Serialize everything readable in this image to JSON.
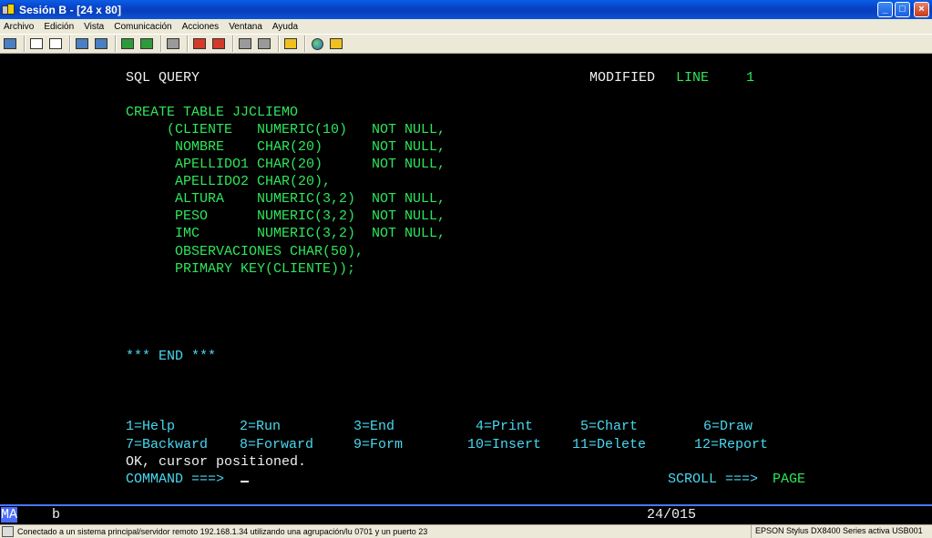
{
  "window": {
    "title": "Sesión B - [24 x 80]",
    "min_glyph": "_",
    "max_glyph": "□",
    "close_glyph": "×"
  },
  "menu": [
    "Archivo",
    "Edición",
    "Vista",
    "Comunicación",
    "Acciones",
    "Ventana",
    "Ayuda"
  ],
  "toolbar": {
    "icons": [
      "print-screen-icon",
      "copy-icon",
      "paste-icon",
      "send-icon",
      "receive-icon",
      "display-icon",
      "session-icon",
      "chart-icon",
      "record-macro-icon",
      "stop-macro-icon",
      "play-macro-icon",
      "macro-icon",
      "clipboard-icon",
      "globe-icon",
      "settings-icon"
    ]
  },
  "terminal": {
    "header_left": "SQL QUERY",
    "header_modified": "MODIFIED",
    "header_line_label": "LINE",
    "header_line_num": "1",
    "sql_lines": [
      "CREATE TABLE JJCLIEMO",
      "     (CLIENTE   NUMERIC(10)   NOT NULL,",
      "      NOMBRE    CHAR(20)      NOT NULL,",
      "      APELLIDO1 CHAR(20)      NOT NULL,",
      "      APELLIDO2 CHAR(20),",
      "      ALTURA    NUMERIC(3,2)  NOT NULL,",
      "      PESO      NUMERIC(3,2)  NOT NULL,",
      "      IMC       NUMERIC(3,2)  NOT NULL,",
      "      OBSERVACIONES CHAR(50),",
      "      PRIMARY KEY(CLIENTE));"
    ],
    "end_marker": "*** END ***",
    "fkeys_row1": [
      {
        "label": "1=Help",
        "col": 0
      },
      {
        "label": "2=Run",
        "col": 13
      },
      {
        "label": "3=End",
        "col": 26
      },
      {
        "label": "4=Print",
        "col": 40
      },
      {
        "label": "5=Chart",
        "col": 52
      },
      {
        "label": "6=Draw",
        "col": 66
      }
    ],
    "fkeys_row2": [
      {
        "label": "7=Backward",
        "col": 0
      },
      {
        "label": "8=Forward",
        "col": 13
      },
      {
        "label": "9=Form",
        "col": 26
      },
      {
        "label": "10=Insert",
        "col": 39
      },
      {
        "label": "11=Delete",
        "col": 51
      },
      {
        "label": "12=Report",
        "col": 65
      }
    ],
    "message": "OK, cursor positioned.",
    "command_label": "COMMAND ===>",
    "command_value": "",
    "scroll_label": "SCROLL ===>",
    "scroll_value": "PAGE"
  },
  "oia": {
    "mode": "MA",
    "session": "b",
    "cursor_pos": "24/015"
  },
  "status": {
    "left": "Conectado a un sistema principal/servidor remoto 192.168.1.34 utilizando una agrupación/lu 0701 y un puerto 23",
    "right": "EPSON Stylus DX8400 Series activa USB001"
  }
}
